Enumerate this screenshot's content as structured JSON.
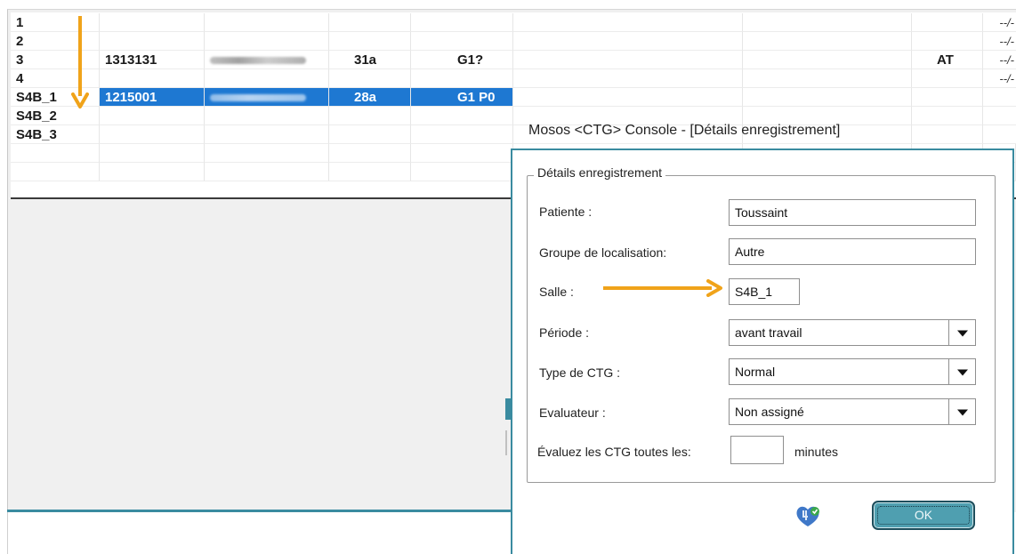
{
  "grid": {
    "rows": [
      {
        "id": "1",
        "num": "",
        "age": "",
        "group": "",
        "status": "",
        "tail": "--/-",
        "has_name": false
      },
      {
        "id": "2",
        "num": "",
        "age": "",
        "group": "",
        "status": "",
        "tail": "--/-",
        "has_name": false
      },
      {
        "id": "3",
        "num": "1313131",
        "age": "31a",
        "group": "G1?",
        "status": "AT",
        "tail": "--/-",
        "has_name": true
      },
      {
        "id": "4",
        "num": "",
        "age": "",
        "group": "",
        "status": "",
        "tail": "--/-",
        "has_name": false
      },
      {
        "id": "S4B_1",
        "num": "1215001",
        "age": "28a",
        "group": "G1 P0",
        "status": "",
        "tail": "",
        "has_name": true,
        "selected": true
      },
      {
        "id": "S4B_2",
        "num": "",
        "age": "",
        "group": "",
        "status": "",
        "tail": "",
        "has_name": false
      },
      {
        "id": "S4B_3",
        "num": "",
        "age": "",
        "group": "",
        "status": "",
        "tail": "",
        "has_name": false
      }
    ]
  },
  "dialog": {
    "title": "Mosos <CTG> Console - [Détails enregistrement]",
    "group_title": "Détails enregistrement",
    "patient_label": "Patiente :",
    "patient_value": "Toussaint",
    "location_label": "Groupe de localisation:",
    "location_value": "Autre",
    "room_label": "Salle :",
    "room_value": "S4B_1",
    "period_label": "Période :",
    "period_value": "avant travail",
    "ctg_type_label": "Type de CTG :",
    "ctg_type_value": "Normal",
    "evaluator_label": "Evaluateur :",
    "evaluator_value": "Non assigné",
    "interval_label": "Évaluez les CTG toutes les:",
    "interval_value": "",
    "interval_unit": "minutes",
    "ok_label": "OK"
  },
  "colors": {
    "arrow": "#f0a31a",
    "accent_teal": "#3a8ba0",
    "selection": "#1e78d2"
  },
  "icons": {
    "help": "help-badge-icon",
    "dropdown": "chevron-down-icon"
  }
}
